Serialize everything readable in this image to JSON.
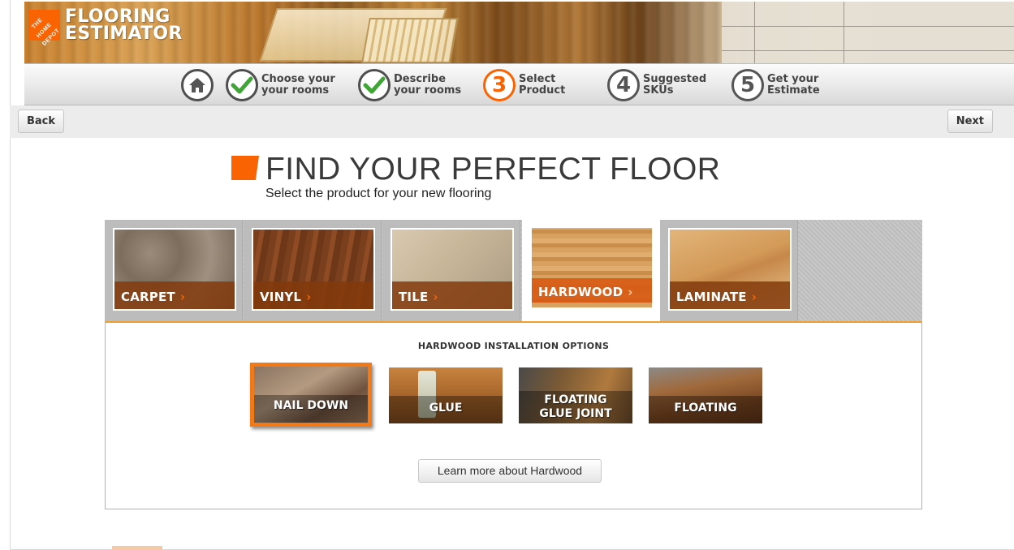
{
  "banner": {
    "logo_text": "THE HOME DEPOT",
    "brand_line1": "FLOORING",
    "brand_line2": "ESTIMATOR"
  },
  "steps": [
    {
      "icon": "home-icon",
      "line1": "",
      "line2": "",
      "state": "home"
    },
    {
      "icon": "check-icon",
      "glyph": "✔",
      "line1": "Choose your",
      "line2": "your rooms",
      "state": "done"
    },
    {
      "icon": "check-icon",
      "glyph": "✔",
      "line1": "Describe",
      "line2": "your rooms",
      "state": "done"
    },
    {
      "icon": "step-3-icon",
      "glyph": "3",
      "line1": "Select",
      "line2": "Product",
      "state": "current"
    },
    {
      "icon": "step-4-icon",
      "glyph": "4",
      "line1": "Suggested",
      "line2": "SKUs",
      "state": "todo"
    },
    {
      "icon": "step-5-icon",
      "glyph": "5",
      "line1": "Get your",
      "line2": "Estimate",
      "state": "todo"
    }
  ],
  "nav": {
    "back_label": "Back",
    "next_label": "Next"
  },
  "heading": {
    "title": "FIND YOUR PERFECT FLOOR",
    "subtitle": "Select the product for your new flooring"
  },
  "products": [
    {
      "label": "CARPET",
      "active": false
    },
    {
      "label": "VINYL",
      "active": false
    },
    {
      "label": "TILE",
      "active": false
    },
    {
      "label": "HARDWOOD",
      "active": true
    },
    {
      "label": "LAMINATE",
      "active": false
    }
  ],
  "product_arrow": "›",
  "options": {
    "title": "HARDWOOD INSTALLATION OPTIONS",
    "items": [
      {
        "label": "NAIL DOWN",
        "selected": true
      },
      {
        "label": "GLUE",
        "selected": false
      },
      {
        "label": "FLOATING GLUE JOINT",
        "line1": "FLOATING",
        "line2": "GLUE JOINT",
        "selected": false
      },
      {
        "label": "FLOATING",
        "selected": false
      }
    ],
    "learn_more_label": "Learn more about Hardwood"
  },
  "colors": {
    "brand_orange": "#f96302",
    "panel_border": "#d6b347"
  }
}
